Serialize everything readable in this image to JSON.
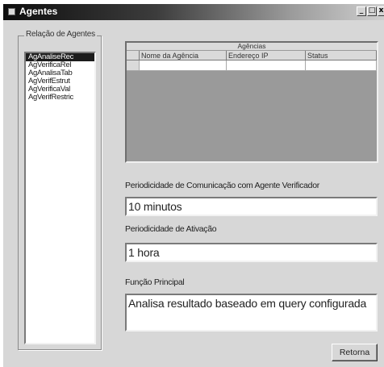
{
  "window": {
    "title": "Agentes",
    "min_symbol": "_",
    "max_symbol": "□",
    "close_symbol": "x"
  },
  "agents_group": {
    "label": "Relação de Agentes",
    "items": [
      "AgAnaliseRec",
      "AgVerificaRel",
      "AgAnalisaTab",
      "AgVerifEstrut",
      "AgVerificaVal",
      "AgVerifRestric"
    ],
    "selected_index": 0
  },
  "agencias_grid": {
    "caption": "Agências",
    "columns": [
      "Nome da Agência",
      "Endereço IP",
      "Status"
    ],
    "rows": [
      [
        "",
        "",
        ""
      ]
    ]
  },
  "periodicidade_comunicacao": {
    "label": "Periodicidade de Comunicação com Agente Verificador",
    "value": "10 minutos"
  },
  "periodicidade_ativacao": {
    "label": "Periodicidade de Ativação",
    "value": "1 hora"
  },
  "funcao_principal": {
    "label": "Função Principal",
    "value": "Analisa resultado baseado em query configurada"
  },
  "retorna_button": {
    "label": "Retorna"
  }
}
